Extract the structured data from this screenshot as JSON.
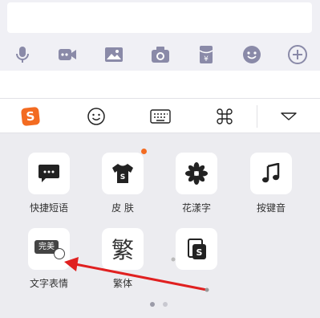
{
  "chat": {
    "input_value": "",
    "attachments": [
      {
        "icon": "microphone-icon"
      },
      {
        "icon": "video-icon"
      },
      {
        "icon": "image-icon"
      },
      {
        "icon": "camera-icon"
      },
      {
        "icon": "red-packet-icon",
        "glyph": "¥"
      },
      {
        "icon": "emoji-icon"
      },
      {
        "icon": "plus-icon"
      }
    ]
  },
  "ime_toolbar": {
    "logo_text": "S",
    "accent_color": "#f36b21",
    "items": [
      "sogou-logo-icon",
      "emoji-face-icon",
      "keyboard-icon",
      "command-icon",
      "collapse-triangle-icon"
    ]
  },
  "panel": {
    "tiles": [
      {
        "label": "快捷短语",
        "icon": "chat-bubble-icon"
      },
      {
        "label": "皮 肤",
        "icon": "tshirt-icon",
        "badge": true
      },
      {
        "label": "花漾字",
        "icon": "flower-icon"
      },
      {
        "label": "按键音",
        "icon": "music-note-icon"
      },
      {
        "label": "文字表情",
        "icon": "text-emoji-icon",
        "inner_text": "完美"
      },
      {
        "label": "繁体",
        "icon": "traditional-char-icon",
        "inner_text": "繁"
      },
      {
        "label": "",
        "icon": "sogou-card-icon"
      }
    ],
    "pager": {
      "count": 2,
      "active": 0
    }
  },
  "annotation": {
    "color": "#e02020",
    "icon": "red-arrow-annotation"
  }
}
